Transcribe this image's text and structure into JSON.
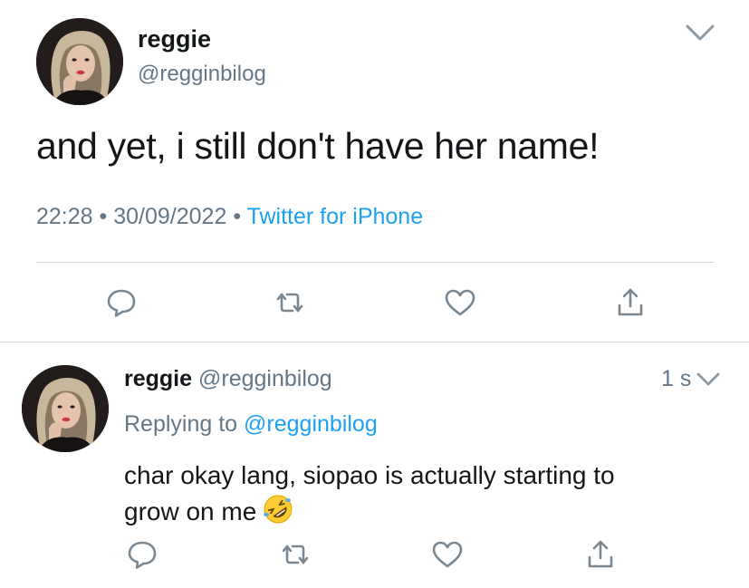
{
  "main_tweet": {
    "display_name": "reggie",
    "handle": "@regginbilog",
    "text": "and yet, i still don't have her name!",
    "time": "22:28",
    "date": "30/09/2022",
    "separator": "•",
    "source": "Twitter for iPhone",
    "avatar_icon": "avatar-photo",
    "menu_icon": "chevron-down-icon"
  },
  "main_actions": [
    {
      "icon": "reply-icon"
    },
    {
      "icon": "retweet-icon"
    },
    {
      "icon": "like-icon"
    },
    {
      "icon": "share-icon"
    }
  ],
  "reply_tweet": {
    "display_name": "reggie",
    "handle": "@regginbilog",
    "timestamp": "1 s",
    "replying_prefix": "Replying to",
    "replying_handle": "@regginbilog",
    "text_line1": "char okay lang, siopao is actually starting to",
    "text_line2": "grow on me",
    "emoji": "rolling-on-floor-laughing-emoji",
    "menu_icon": "chevron-down-icon"
  },
  "reply_actions": [
    {
      "icon": "reply-icon"
    },
    {
      "icon": "retweet-icon"
    },
    {
      "icon": "like-icon"
    },
    {
      "icon": "share-icon"
    }
  ],
  "colors": {
    "text": "#14171a",
    "secondary": "#657786",
    "link": "#1da1f2",
    "icon": "#7a8791",
    "divider": "#cfd5da"
  }
}
